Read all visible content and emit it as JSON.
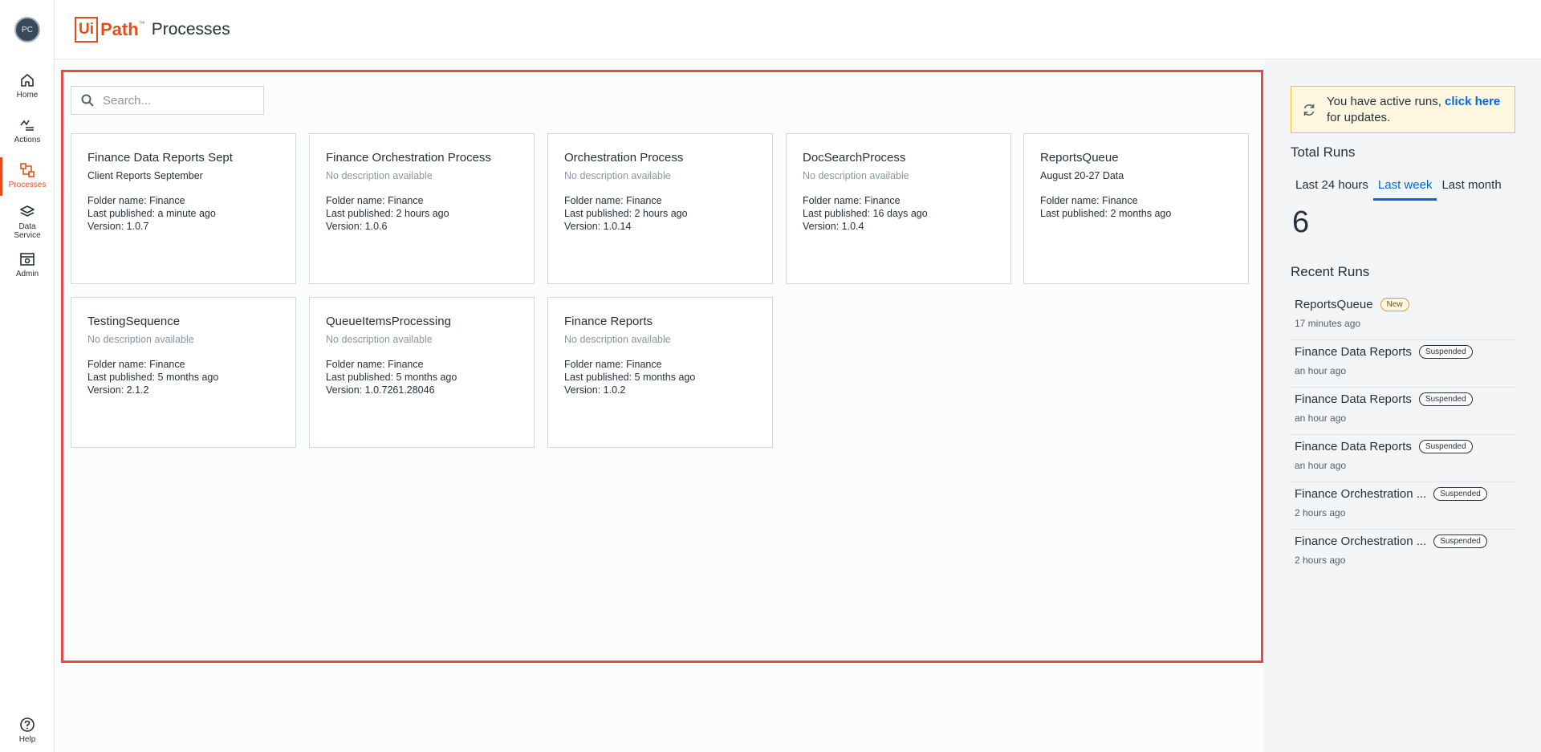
{
  "user": {
    "initials": "PC"
  },
  "nav": {
    "home": "Home",
    "actions": "Actions",
    "processes": "Processes",
    "data_service_line1": "Data",
    "data_service_line2": "Service",
    "admin": "Admin",
    "help": "Help"
  },
  "header": {
    "logo_ui": "Ui",
    "logo_path": "Path",
    "logo_tm": "™",
    "title": "Processes"
  },
  "search": {
    "placeholder": "Search..."
  },
  "processes": [
    {
      "title": "Finance Data Reports Sept",
      "description": "Client Reports September",
      "folder": "Folder name: Finance",
      "published": "Last published: a minute ago",
      "version": "Version: 1.0.7"
    },
    {
      "title": "Finance Orchestration Process",
      "description": "No description available",
      "folder": "Folder name: Finance",
      "published": "Last published: 2 hours ago",
      "version": "Version: 1.0.6"
    },
    {
      "title": "Orchestration Process",
      "description": "No description available",
      "folder": "Folder name: Finance",
      "published": "Last published: 2 hours ago",
      "version": "Version: 1.0.14"
    },
    {
      "title": "DocSearchProcess",
      "description": "No description available",
      "folder": "Folder name: Finance",
      "published": "Last published: 16 days ago",
      "version": "Version: 1.0.4"
    },
    {
      "title": "ReportsQueue",
      "description": "August 20-27 Data",
      "folder": "Folder name: Finance",
      "published": "Last published: 2 months ago",
      "version": ""
    },
    {
      "title": "TestingSequence",
      "description": "No description available",
      "folder": "Folder name: Finance",
      "published": "Last published: 5 months ago",
      "version": "Version: 2.1.2"
    },
    {
      "title": "QueueItemsProcessing",
      "description": "No description available",
      "folder": "Folder name: Finance",
      "published": "Last published: 5 months ago",
      "version": "Version: 1.0.7261.28046"
    },
    {
      "title": "Finance Reports",
      "description": "No description available",
      "folder": "Folder name: Finance",
      "published": "Last published: 5 months ago",
      "version": "Version: 1.0.2"
    }
  ],
  "banner": {
    "text_before": "You have active runs, ",
    "link": "click here",
    "text_after": " for updates."
  },
  "total_runs": {
    "heading": "Total Runs",
    "tabs": [
      "Last 24 hours",
      "Last week",
      "Last month"
    ],
    "active_tab": "Last week",
    "count": "6"
  },
  "recent_runs": {
    "heading": "Recent Runs",
    "items": [
      {
        "name": "ReportsQueue",
        "status": "New",
        "time": "17 minutes ago"
      },
      {
        "name": "Finance Data Reports",
        "status": "Suspended",
        "time": "an hour ago"
      },
      {
        "name": "Finance Data Reports",
        "status": "Suspended",
        "time": "an hour ago"
      },
      {
        "name": "Finance Data Reports",
        "status": "Suspended",
        "time": "an hour ago"
      },
      {
        "name": "Finance Orchestration ...",
        "status": "Suspended",
        "time": "2 hours ago"
      },
      {
        "name": "Finance Orchestration ...",
        "status": "Suspended",
        "time": "2 hours ago"
      }
    ]
  },
  "colors": {
    "brand": "#e54d1f",
    "link": "#0067df",
    "focus_frame": "#e24b4b",
    "banner_bg": "#fff7e0"
  }
}
